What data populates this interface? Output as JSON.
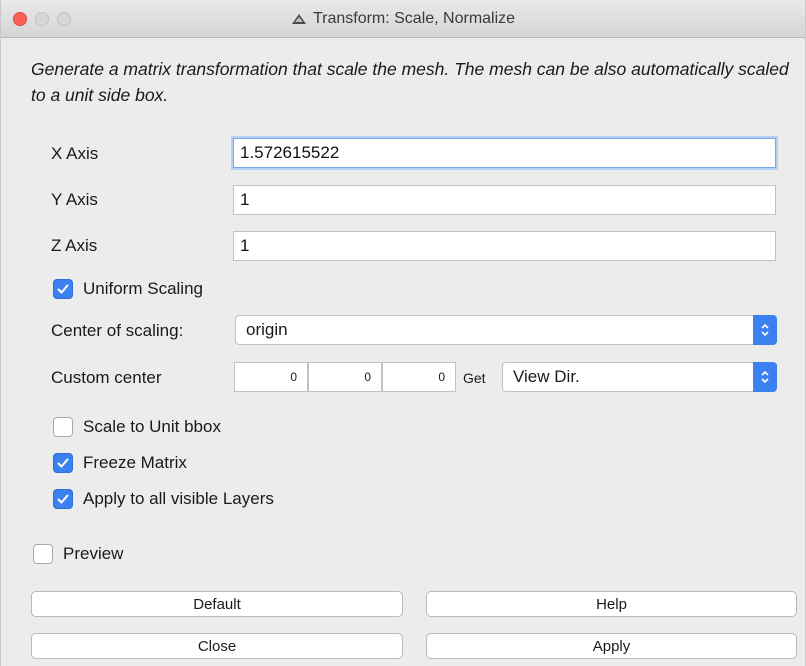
{
  "window": {
    "title": "Transform: Scale, Normalize",
    "colors": {
      "accent": "#3b82f0",
      "close_light": "#fc5f57"
    }
  },
  "description": "Generate a matrix transformation that scale the mesh. The mesh can be also automatically scaled to a unit side box.",
  "fields": {
    "x_axis": {
      "label": "X Axis",
      "value": "1.572615522"
    },
    "y_axis": {
      "label": "Y Axis",
      "value": "1"
    },
    "z_axis": {
      "label": "Z Axis",
      "value": "1"
    }
  },
  "uniform_scaling": {
    "label": "Uniform Scaling",
    "checked": true
  },
  "center_of_scaling": {
    "label": "Center of scaling:",
    "selected": "origin"
  },
  "custom_center": {
    "label": "Custom center",
    "values": [
      "0",
      "0",
      "0"
    ],
    "get_label": "Get",
    "direction_selected": "View Dir."
  },
  "scale_to_unit_bbox": {
    "label": "Scale to Unit bbox",
    "checked": false
  },
  "freeze_matrix": {
    "label": "Freeze Matrix",
    "checked": true
  },
  "apply_all_layers": {
    "label": "Apply to all visible Layers",
    "checked": true
  },
  "preview": {
    "label": "Preview",
    "checked": false
  },
  "buttons": {
    "default": "Default",
    "help": "Help",
    "close": "Close",
    "apply": "Apply"
  }
}
